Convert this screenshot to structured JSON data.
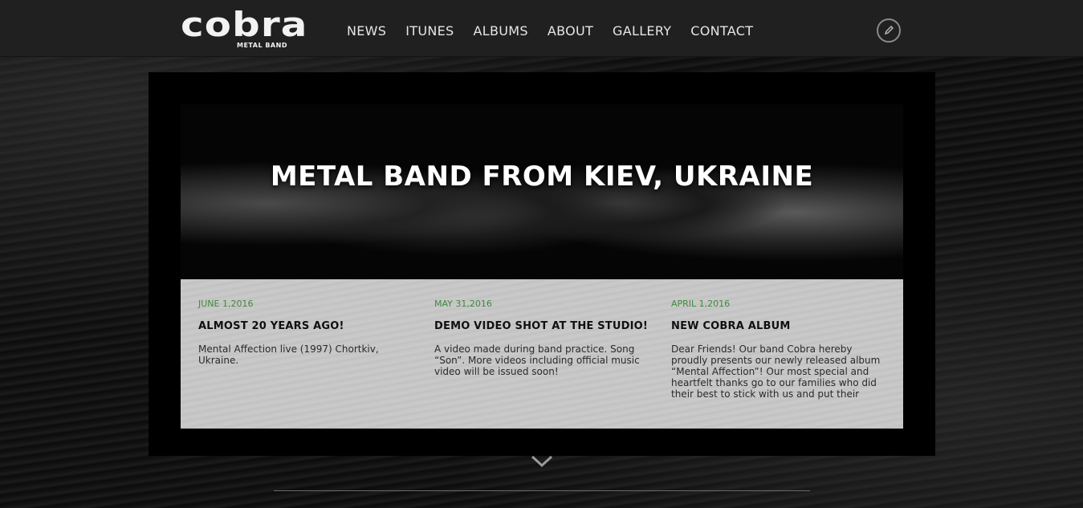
{
  "logo": {
    "text": "cobra",
    "subtitle": "METAL BAND"
  },
  "nav": {
    "items": [
      {
        "label": "NEWS"
      },
      {
        "label": "ITUNES"
      },
      {
        "label": "ALBUMS"
      },
      {
        "label": "ABOUT"
      },
      {
        "label": "GALLERY"
      },
      {
        "label": "CONTACT"
      }
    ]
  },
  "header": {
    "edit_icon": "pencil-icon"
  },
  "hero": {
    "title": "METAL BAND FROM KIEV, UKRAINE"
  },
  "news": [
    {
      "date": "JUNE 1,2016",
      "title": "ALMOST 20 YEARS AGO!",
      "body": "Mental Affection live (1997) Chortkiv, Ukraine."
    },
    {
      "date": "MAY 31,2016",
      "title": "DEMO VIDEO SHOT AT THE STUDIO!",
      "body": "A video made during band practice. Song “Son”. More videos including official music video will be issued soon!"
    },
    {
      "date": "APRIL 1,2016",
      "title": "NEW COBRA ALBUM",
      "body": "Dear Friends! Our band Cobra hereby proudly presents our newly released album “Mental Affection”! Our most special and heartfelt thanks go to our families who did their best to stick with us and put their"
    }
  ],
  "scroll": {
    "icon": "chevron-down-icon"
  },
  "colors": {
    "accent_green": "#3e8a3e",
    "panel": "#c6c6c6",
    "header": "#202020"
  }
}
